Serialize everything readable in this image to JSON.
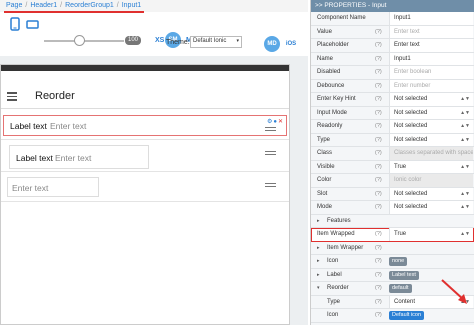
{
  "breadcrumb": {
    "items": [
      "Page",
      "Header1",
      "ReorderGroup1",
      "Input1"
    ]
  },
  "toolbar": {
    "zoom": "100",
    "breakpoints": [
      "XS",
      "SM",
      "MD",
      "LG",
      "XL"
    ],
    "theme_label": "Theme:",
    "theme_value": "Default Ionic",
    "md_label": "MD",
    "ios_label": "iOS"
  },
  "canvas": {
    "toolbar_title": "Reorder",
    "item1": {
      "label": "Label text",
      "placeholder": "Enter text"
    },
    "item2": {
      "label": "Label text",
      "placeholder": "Enter text"
    },
    "item3": {
      "placeholder": "Enter text"
    }
  },
  "panel": {
    "header": ">> PROPERTIES - Input",
    "rows": [
      {
        "name": "Component Name",
        "value": "Input1"
      },
      {
        "name": "Value",
        "q": "(?)",
        "placeholder": "Enter text"
      },
      {
        "name": "Placeholder",
        "q": "(?)",
        "value": "Enter text"
      },
      {
        "name": "Name",
        "q": "(?)",
        "value": "Input1"
      },
      {
        "name": "Disabled",
        "q": "(?)",
        "placeholder": "Enter boolean"
      },
      {
        "name": "Debounce",
        "q": "(?)",
        "placeholder": "Enter number"
      },
      {
        "name": "Enter Key Hint",
        "q": "(?)",
        "value": "Not selected"
      },
      {
        "name": "Input Mode",
        "q": "(?)",
        "value": "Not selected"
      },
      {
        "name": "Readonly",
        "q": "(?)",
        "value": "Not selected"
      },
      {
        "name": "Type",
        "q": "(?)",
        "value": "Not selected"
      },
      {
        "name": "Class",
        "q": "(?)",
        "placeholder": "Classes separated with space"
      },
      {
        "name": "Visible",
        "q": "(?)",
        "value": "True"
      },
      {
        "name": "Color",
        "q": "(?)",
        "placeholder": "Ionic color"
      },
      {
        "name": "Slot",
        "q": "(?)",
        "value": "Not selected"
      },
      {
        "name": "Mode",
        "q": "(?)",
        "value": "Not selected"
      }
    ],
    "sections": {
      "features": "Features",
      "item_wrapped": {
        "name": "Item Wrapped",
        "q": "(?)",
        "value": "True"
      },
      "item_wrapper": {
        "name": "Item Wrapper",
        "q": "(?)"
      },
      "icon": {
        "name": "Icon",
        "q": "(?)",
        "chip": "none"
      },
      "label": {
        "name": "Label",
        "q": "(?)",
        "chip": "Label text"
      },
      "reorder": {
        "name": "Reorder",
        "q": "(?)",
        "chip": "default"
      },
      "type": {
        "name": "Type",
        "q": "(?)",
        "value": "Content"
      },
      "icon2": {
        "name": "Icon",
        "q": "(?)",
        "chip": "Default icon"
      }
    }
  },
  "colors": {
    "accent": "#2a7fd4",
    "highlight": "#e0302f",
    "panel_header": "#6f8ea8",
    "chip_gray": "#7b8a97",
    "chip_blue": "#2a7fd4"
  },
  "icons": [
    "mobile-icon",
    "tablet-icon",
    "hamburger-icon",
    "reorder-grip-icon",
    "chevron-right-icon",
    "settings-icon",
    "close-icon"
  ]
}
